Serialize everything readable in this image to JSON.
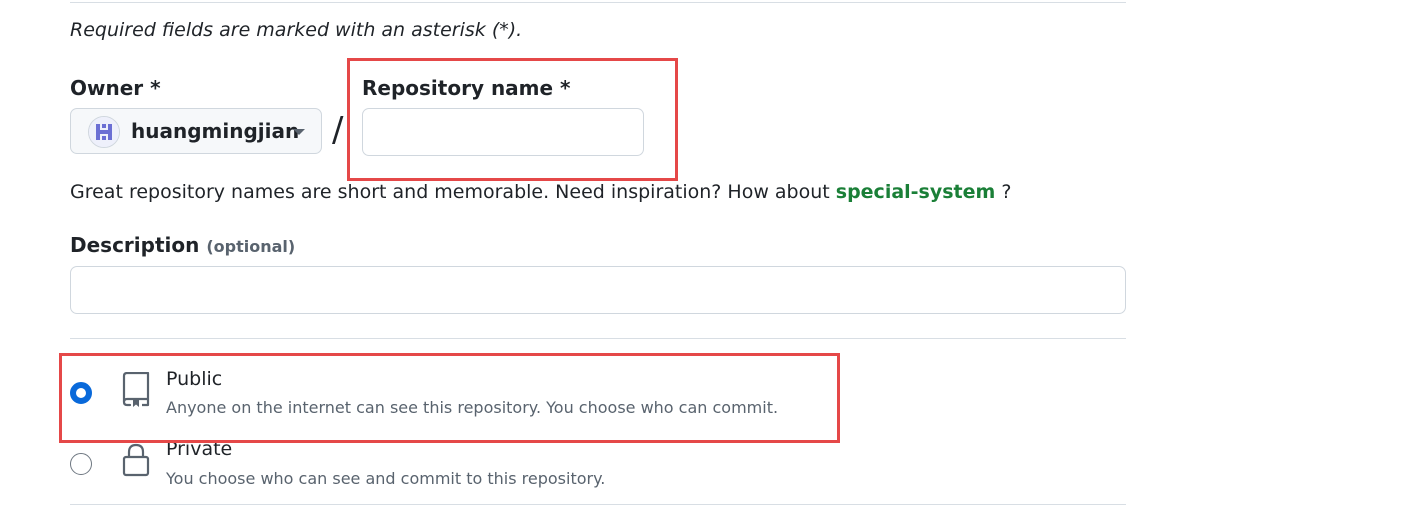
{
  "form": {
    "required_note": "Required fields are marked with an asterisk (*).",
    "owner": {
      "label": "Owner *",
      "selected": "huangmingjian"
    },
    "separator": "/",
    "repo_name": {
      "label": "Repository name *",
      "value": "",
      "placeholder": ""
    },
    "name_hint": {
      "prefix": "Great repository names are short and memorable. Need inspiration? How about ",
      "suggestion": "special-system",
      "suffix": " ?"
    },
    "description": {
      "label": "Description",
      "optional": "(optional)",
      "value": "",
      "placeholder": ""
    },
    "visibility": {
      "options": [
        {
          "title": "Public",
          "description": "Anyone on the internet can see this repository. You choose who can commit.",
          "icon": "repo-icon",
          "checked": true
        },
        {
          "title": "Private",
          "description": "You choose who can see and commit to this repository.",
          "icon": "lock-icon",
          "checked": false
        }
      ]
    }
  },
  "colors": {
    "accent": "#0969da",
    "suggestion": "#1a7f37",
    "annotation": "#e54848",
    "border": "#d0d7de"
  }
}
